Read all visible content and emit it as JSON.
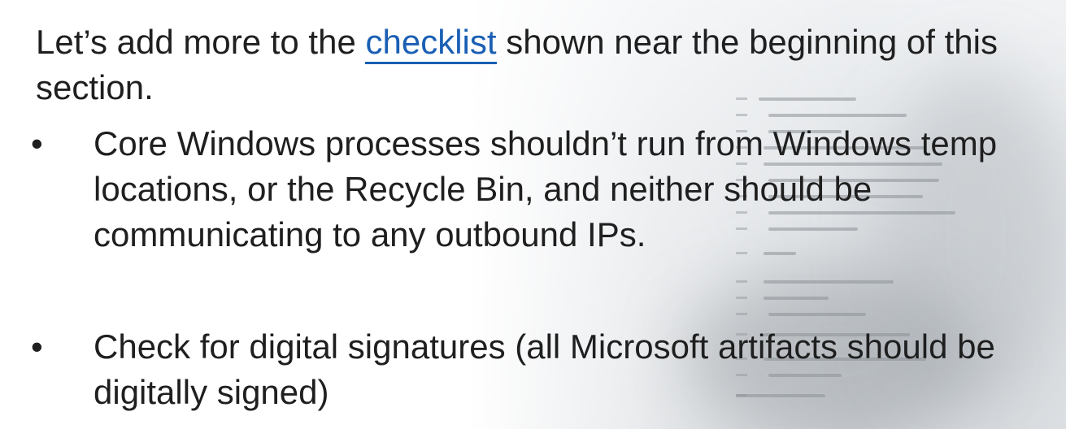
{
  "slide": {
    "intro_before_link": "Let’s add more to the ",
    "intro_link": "checklist",
    "intro_after_link": " shown near the beginning of this section.",
    "bullets": [
      {
        "marker": "•",
        "text": "Core Windows processes shouldn’t run from Windows temp locations, or the Recycle Bin, and neither should be communicating to any outbound IPs."
      },
      {
        "marker": "•",
        "text": "Check for digital signatures (all Microsoft artifacts should be digitally signed)"
      }
    ]
  },
  "colors": {
    "text": "#1f1f1f",
    "link": "#1a5fb4",
    "background": "#ffffff"
  }
}
